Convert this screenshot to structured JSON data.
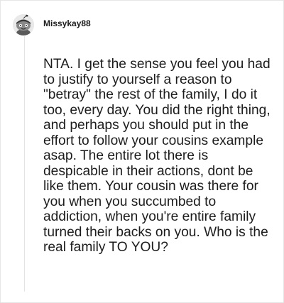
{
  "comment": {
    "username": "Missykay88",
    "body": "NTA. I get the sense you feel you had to justify to yourself a reason to \"betray\" the rest of the family, I do it too, every day. You did the right thing, and perhaps you should put in the effort to follow your cousins example asap. The entire lot there is despicable in their actions, dont be like them. Your cousin was there for you when you succumbed to addiction, when you're entire family turned their backs on you. Who is the real family TO YOU?"
  },
  "avatar_icon": "snoo-avatar-icon"
}
